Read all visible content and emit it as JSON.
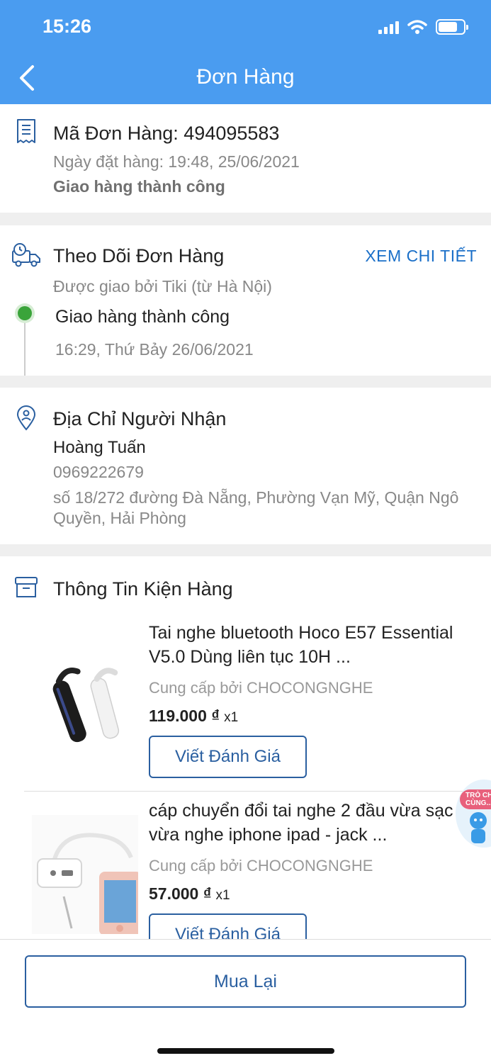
{
  "status_bar": {
    "time": "15:26"
  },
  "header": {
    "title": "Đơn Hàng"
  },
  "order": {
    "code_label": "Mã Đơn Hàng: 494095583",
    "date_label": "Ngày đặt hàng: 19:48, 25/06/2021",
    "status": "Giao hàng thành công"
  },
  "tracking": {
    "title": "Theo Dõi Đơn Hàng",
    "detail_link": "XEM CHI TIẾT",
    "carrier": "Được giao bởi Tiki (từ Hà Nội)",
    "event_status": "Giao hàng thành công",
    "event_time": "16:29, Thứ Bảy 26/06/2021"
  },
  "recipient": {
    "title": "Địa Chỉ Người Nhận",
    "name": "Hoàng Tuấn",
    "phone": "0969222679",
    "address": "số 18/272 đường Đà Nẵng, Phường Vạn Mỹ, Quận Ngô Quyền, Hải Phòng"
  },
  "package": {
    "title": "Thông Tin Kiện Hàng",
    "items": [
      {
        "name": "Tai nghe bluetooth Hoco E57 Essential V5.0 Dùng liên tục 10H ...",
        "seller": "Cung cấp bởi CHOCONGNGHE",
        "price": "119.000 ₫",
        "qty": "x1",
        "review_label": "Viết Đánh Giá"
      },
      {
        "name": "cáp chuyển đổi tai nghe 2 đầu vừa sạc vừa nghe iphone ipad - jack ...",
        "seller": "Cung cấp bởi CHOCONGNGHE",
        "price": "57.000 ₫",
        "qty": "x1",
        "review_label": "Viết Đánh Giá"
      }
    ]
  },
  "footer": {
    "buy_again_label": "Mua Lại"
  },
  "floating_widget": {
    "badge_text": "TRÒ CH... CÙNG..."
  },
  "colors": {
    "header": "#4a9cf0",
    "accent": "#2a5fa0",
    "link": "#1a6fc8",
    "success": "#3aa43a"
  }
}
